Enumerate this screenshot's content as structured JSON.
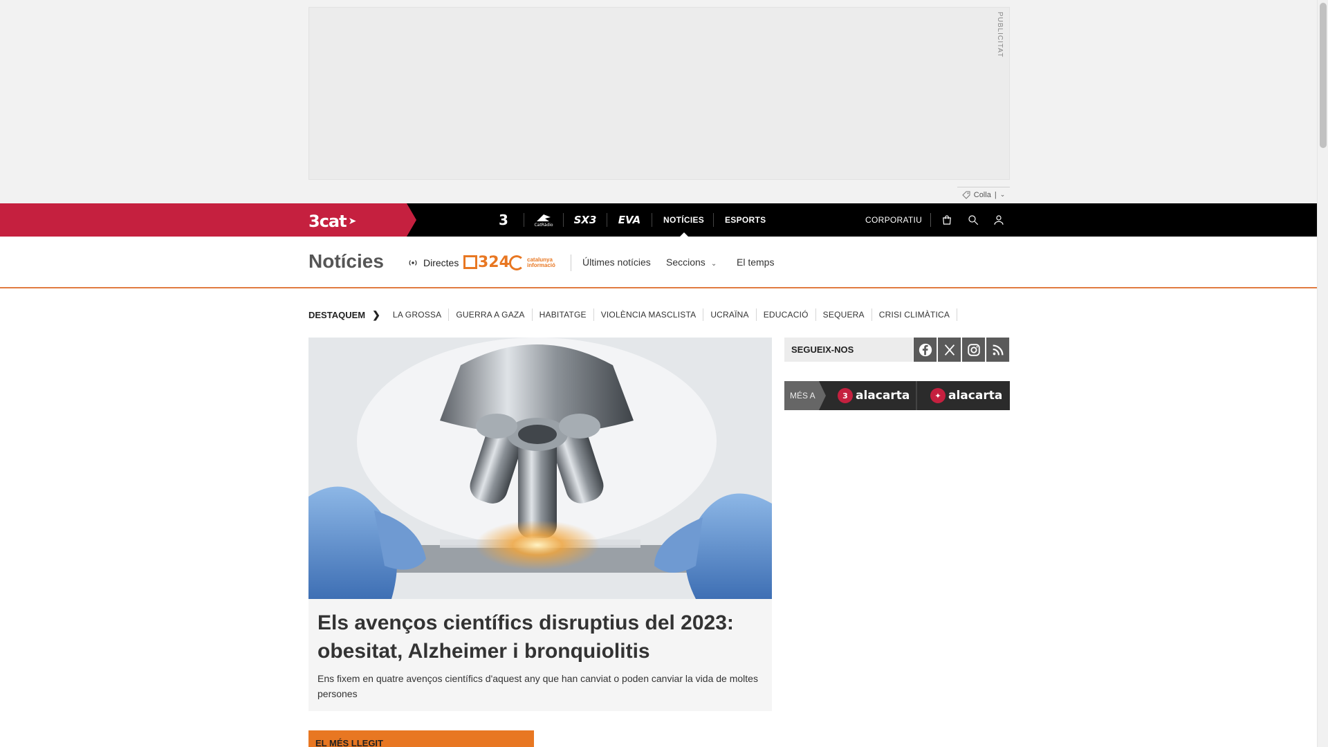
{
  "ad": {
    "label": "PUBLICITAT",
    "collapse_label": "Colla"
  },
  "topnav": {
    "brand": "3cat",
    "channels": [
      {
        "name": "TV3",
        "display": "3"
      },
      {
        "name": "Catalunya Ràdio",
        "display": "CatRàdio"
      },
      {
        "name": "SX3",
        "display": "SX3"
      },
      {
        "name": "EVA",
        "display": "EVA"
      }
    ],
    "links": [
      {
        "label": "NOTÍCIES",
        "active": true
      },
      {
        "label": "ESPORTS",
        "active": false
      }
    ],
    "corporate": "CORPORATIU",
    "icons": [
      "shopping-bag-icon",
      "search-icon",
      "user-icon"
    ]
  },
  "section": {
    "title": "Notícies",
    "directes": "Directes",
    "logo_324": "324",
    "logo_ci_line1": "catalunya",
    "logo_ci_line2": "informació",
    "links": [
      "Últimes notícies",
      "Seccions",
      "El temps"
    ]
  },
  "destaquem": {
    "label": "DESTAQUEM",
    "tags": [
      "LA GROSSA",
      "GUERRA A GAZA",
      "HABITATGE",
      "VIOLÈNCIA MASCLISTA",
      "UCRAÏNA",
      "EDUCACIÓ",
      "SEQUERA",
      "CRISI CLIMÀTICA"
    ]
  },
  "hero": {
    "title": "Els avenços científics disruptius del 2023: obesitat, Alzheimer i bronquiolitis",
    "subtitle": "Ens fixem en quatre avenços científics d'aquest any que han canviat o poden canviar la vida de moltes persones"
  },
  "mes_llegit": "EL MÉS LLEGIT",
  "segueix": {
    "label": "SEGUEIX-NOS",
    "networks": [
      "facebook-icon",
      "x-icon",
      "instagram-icon",
      "rss-icon"
    ]
  },
  "alacarta": {
    "prefix": "MÉS A",
    "items": [
      {
        "badge": "3",
        "text": "alacarta"
      },
      {
        "badge": "✦",
        "text": "alacarta"
      }
    ]
  },
  "colors": {
    "brand_red": "#c5203f",
    "news_orange": "#e87722",
    "nav_black": "#000000"
  }
}
